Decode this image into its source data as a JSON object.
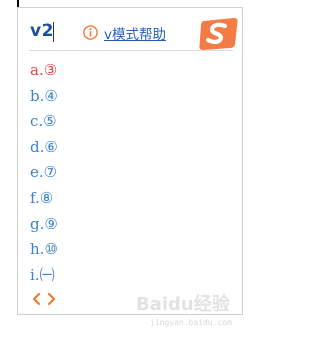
{
  "input": {
    "code": "v2",
    "help_label": "v模式帮助"
  },
  "candidates": [
    {
      "index": "a.",
      "text": "③"
    },
    {
      "index": "b.",
      "text": "④"
    },
    {
      "index": "c.",
      "text": "⑤"
    },
    {
      "index": "d.",
      "text": "⑥"
    },
    {
      "index": "e.",
      "text": "⑦"
    },
    {
      "index": "f.",
      "text": "⑧"
    },
    {
      "index": "g.",
      "text": "⑨"
    },
    {
      "index": "h.",
      "text": "⑩"
    },
    {
      "index": "i.",
      "text": "㈠"
    }
  ],
  "watermark": {
    "text": "Baidu经验",
    "sub": "jingyan.baidu.com"
  },
  "colors": {
    "code": "#1d4f9e",
    "candidate": "#3a82c9",
    "selected": "#e44141",
    "accent": "#f07a39"
  },
  "icons": [
    "info-icon",
    "sogou-logo-icon",
    "prev-page-icon",
    "next-page-icon"
  ]
}
